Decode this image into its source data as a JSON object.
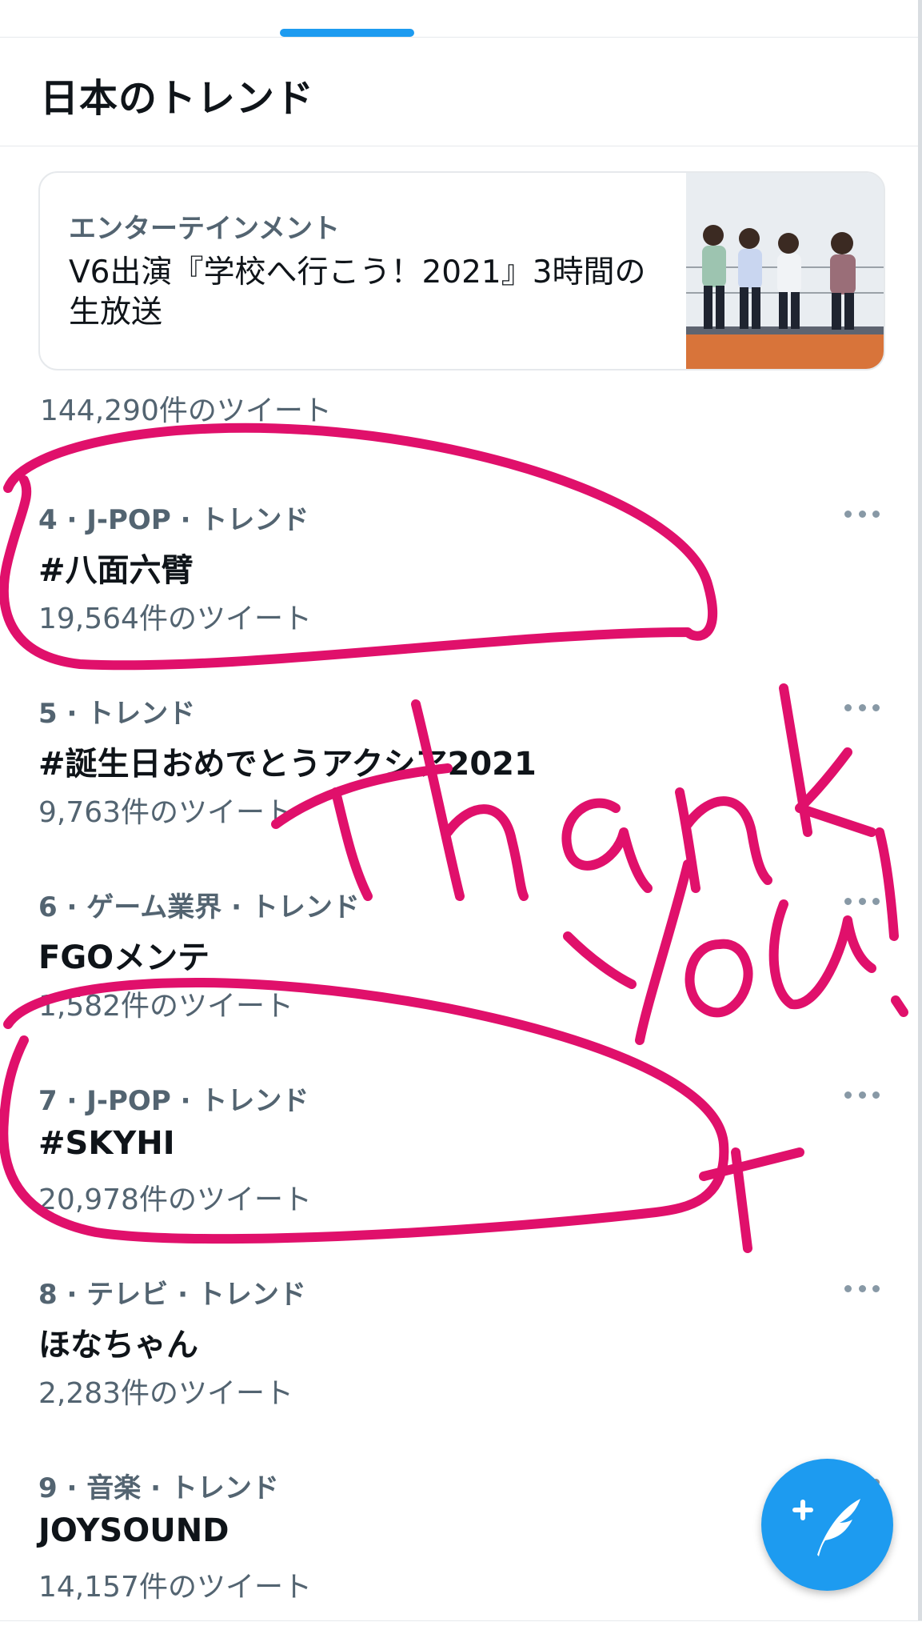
{
  "header": {
    "title": "日本のトレンド"
  },
  "news": {
    "category": "エンターテインメント",
    "headline": "V6出演『学校へ行こう！2021』3時間の生放送",
    "tweet_count": "144,290件のツイート"
  },
  "trends": [
    {
      "meta": "4 · J-POP · トレンド",
      "name": "#八面六臂",
      "count": "19,564件のツイート"
    },
    {
      "meta": "5 · トレンド",
      "name": "#誕生日おめでとうアクシア2021",
      "count": "9,763件のツイート"
    },
    {
      "meta": "6 · ゲーム業界 · トレンド",
      "name": "FGOメンテ",
      "count": "1,582件のツイート"
    },
    {
      "meta": "7 · J-POP · トレンド",
      "name": "#SKYHI",
      "count": "20,978件のツイート"
    },
    {
      "meta": "8 · テレビ · トレンド",
      "name": "ほなちゃん",
      "count": "2,283件のツイート"
    },
    {
      "meta": "9 · 音楽 · トレンド",
      "name": "JOYSOUND",
      "count": "14,157件のツイート"
    }
  ],
  "icons": {
    "more": "more-options-icon",
    "compose": "compose-tweet-icon"
  },
  "colors": {
    "accent": "#1d9bf0",
    "annotation": "#e0106b",
    "secondary_text": "#536471"
  }
}
